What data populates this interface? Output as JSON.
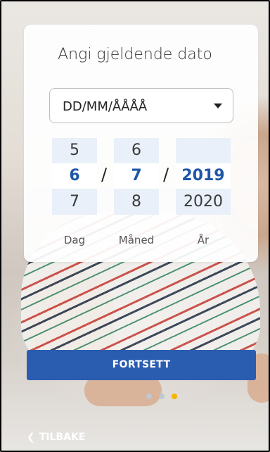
{
  "card": {
    "title": "Angi gjeldende dato",
    "format_dropdown": {
      "selected": "DD/MM/ÅÅÅÅ"
    }
  },
  "picker": {
    "day": {
      "prev": "5",
      "selected": "6",
      "next": "7",
      "label": "Dag"
    },
    "month": {
      "prev": "6",
      "selected": "7",
      "next": "8",
      "label": "Måned"
    },
    "year": {
      "prev": "",
      "selected": "2019",
      "next": "2020",
      "label": "År"
    },
    "separator": "/"
  },
  "actions": {
    "continue_label": "FORTSETT",
    "back_label": "TILBAKE"
  },
  "pager": {
    "count": 3,
    "active_index": 2
  },
  "colors": {
    "primary": "#2a5db0",
    "selected_text": "#1e56a8",
    "dot_active": "#f5b400",
    "dot_inactive": "#bfc7d0"
  },
  "icons": {
    "dropdown": "caret-down-icon",
    "back": "chevron-left-icon"
  }
}
